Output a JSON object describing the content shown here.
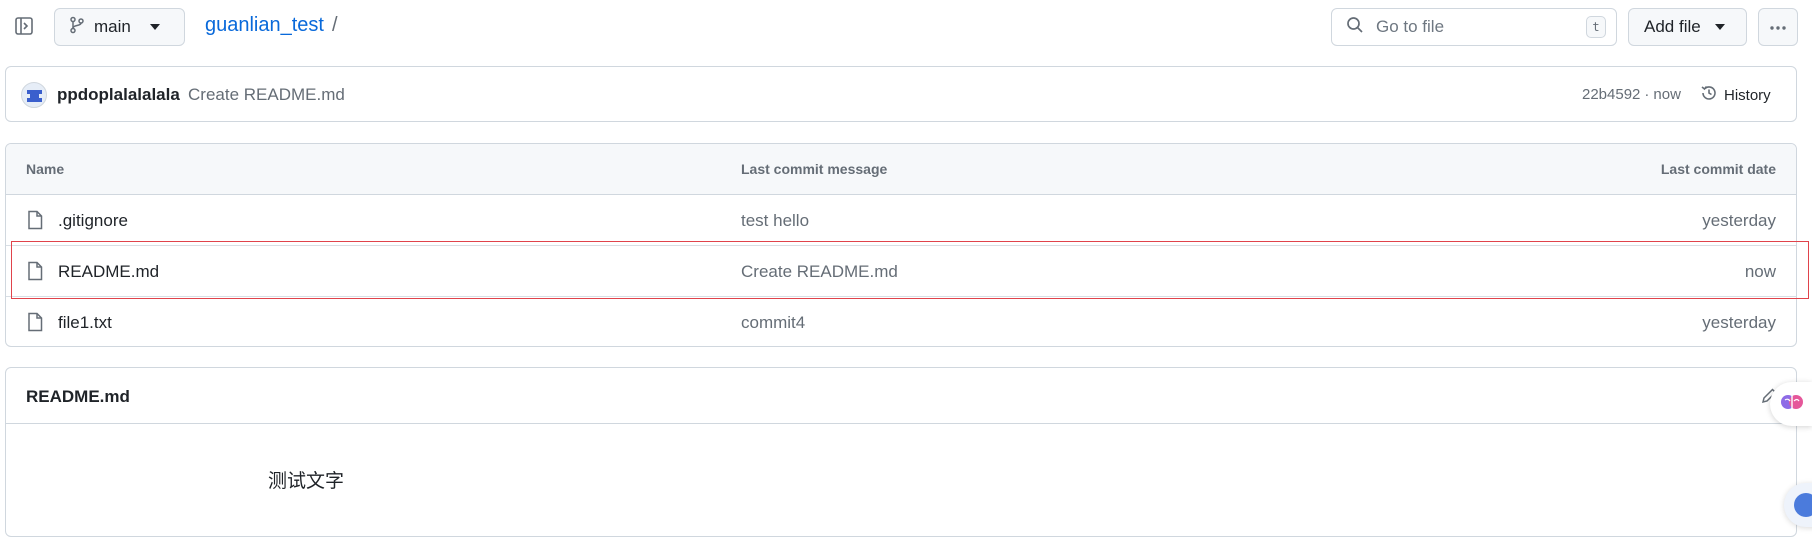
{
  "header": {
    "branch_label": "main",
    "repo_name": "guanlian_test",
    "breadcrumb_sep": "/",
    "goto_placeholder": "Go to file",
    "goto_shortcut": "t",
    "add_file_label": "Add file"
  },
  "latest_commit": {
    "author": "ppdoplalalalala",
    "message": "Create README.md",
    "sha": "22b4592",
    "dot": "·",
    "time": "now",
    "history_label": "History"
  },
  "file_table": {
    "columns": [
      "Name",
      "Last commit message",
      "Last commit date"
    ],
    "rows": [
      {
        "name": ".gitignore",
        "message": "test hello",
        "date": "yesterday"
      },
      {
        "name": "README.md",
        "message": "Create README.md",
        "date": "now"
      },
      {
        "name": "file1.txt",
        "message": "commit4",
        "date": "yesterday"
      }
    ]
  },
  "readme": {
    "title": "README.md",
    "body": "测试文字"
  },
  "colors": {
    "link": "#0969da",
    "border": "#d0d7de",
    "highlight": "#e0434b",
    "muted": "#656d76"
  },
  "icons": [
    "sidebar-toggle-icon",
    "git-branch-icon",
    "search-icon",
    "kebab-horizontal-icon",
    "history-icon",
    "file-icon",
    "pencil-icon",
    "brain-icon"
  ]
}
